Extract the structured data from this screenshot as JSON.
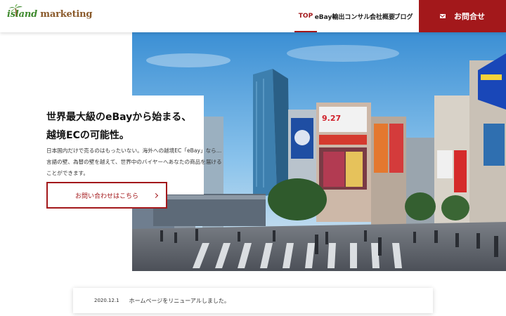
{
  "header": {
    "logo_text_island": "island",
    "logo_text_marketing": "marketing",
    "nav": [
      {
        "label": "TOP",
        "active": true
      },
      {
        "label": "eBay輸出コンサル",
        "has_dropdown": true
      },
      {
        "label": "会社概要",
        "active": false
      },
      {
        "label": "ブログ",
        "active": false
      }
    ],
    "contact_label": "お問合せ",
    "contact_icon": "mail-icon"
  },
  "hero": {
    "title_line1": "世界最大級のeBayから始まる、",
    "title_line2": "越境ECの可能性。",
    "description": "日本国内だけで売るのはもったいない。海外への越境EC「eBay」なら…言語の壁、為替の壁を越えて、世界中のバイヤーへあなたの商品を届けることができます。",
    "cta_label": "お問い合わせはこちら",
    "image_desc": "city-crossing-photo"
  },
  "news": {
    "date": "2020.12.1",
    "title": "ホームページをリニューアルしました。"
  },
  "colors": {
    "accent": "#a3181b",
    "logo_green": "#3f8a2f",
    "logo_brown": "#8a5a2b"
  }
}
